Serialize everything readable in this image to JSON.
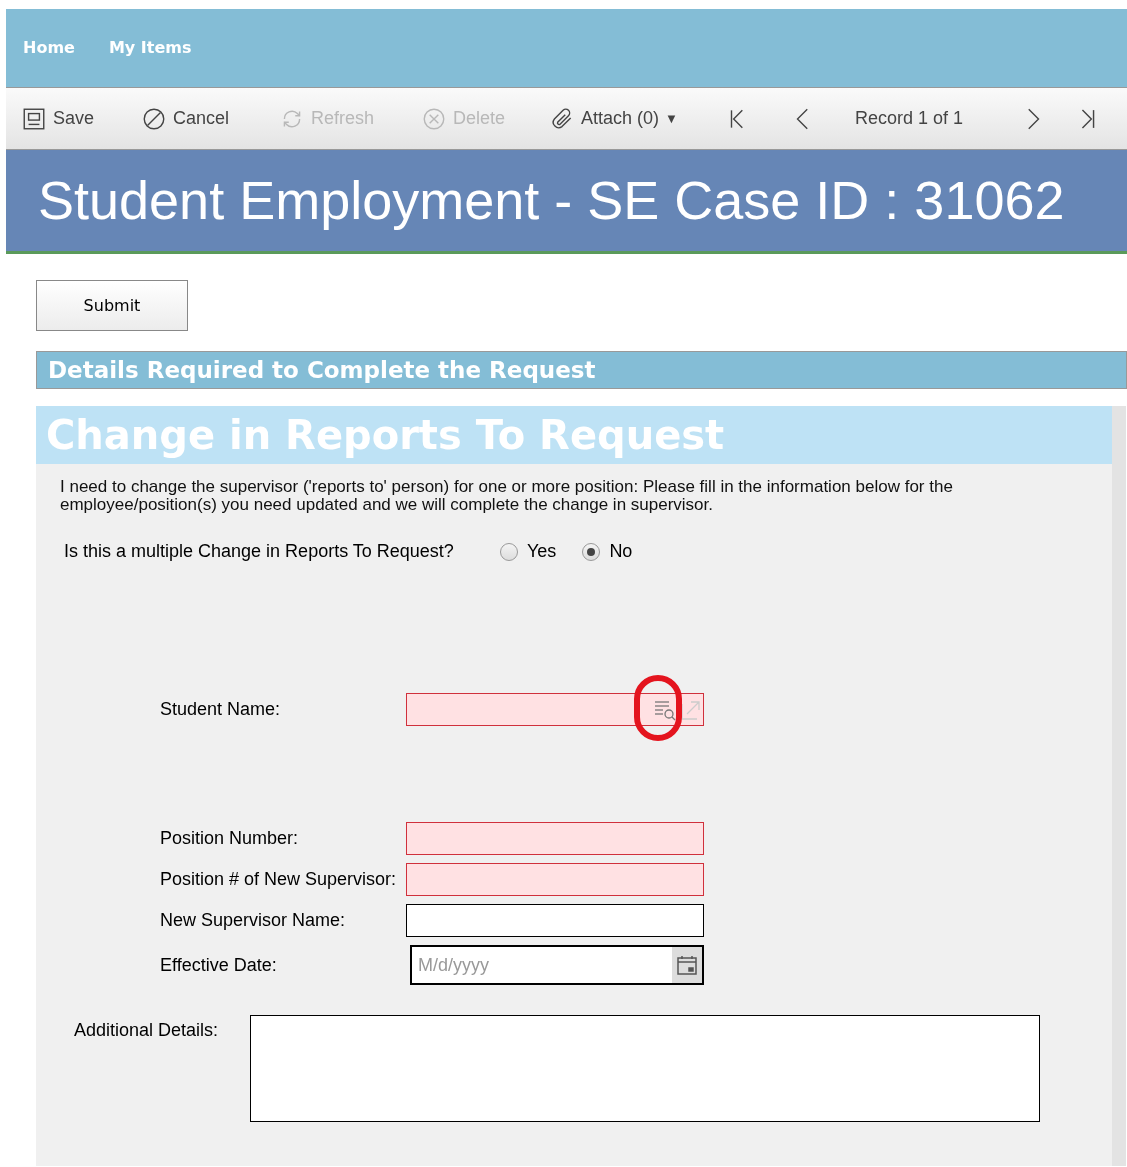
{
  "nav": {
    "items": [
      "Home",
      "My Items"
    ]
  },
  "toolbar": [
    {
      "kind": "save",
      "label": "Save",
      "disabled": false
    },
    {
      "kind": "cancel",
      "label": "Cancel",
      "disabled": false
    },
    {
      "kind": "refresh",
      "label": "Refresh",
      "disabled": true
    },
    {
      "kind": "delete",
      "label": "Delete",
      "disabled": true
    },
    {
      "kind": "attach",
      "label": "Attach (0)",
      "caret": "▼",
      "disabled": false
    },
    {
      "kind": "first",
      "disabled": false
    },
    {
      "kind": "prev",
      "disabled": false
    },
    {
      "kind": "record",
      "label": "Record 1 of 1",
      "disabled": false
    },
    {
      "kind": "next",
      "disabled": false
    },
    {
      "kind": "last",
      "disabled": false
    }
  ],
  "title": "Student Employment - SE Case ID : 31062",
  "submit": "Submit",
  "section_header": "Details Required to Complete the Request",
  "form": {
    "title": "Change in Reports To Request",
    "intro": "I need to change the supervisor ('reports to' person) for one or more position: Please fill in the information below for the employee/position(s) you need updated and we will complete the change in supervisor.",
    "question": "Is this a multiple Change in Reports To Request?",
    "options": [
      {
        "label": "Yes",
        "selected": false
      },
      {
        "label": "No",
        "selected": true
      }
    ],
    "fields": [
      {
        "label": "Student Name:",
        "kind": "lookup",
        "required": true,
        "highlighted": true
      },
      {
        "label": "Position Number:",
        "kind": "text",
        "required": true
      },
      {
        "label": "Position # of New Supervisor:",
        "kind": "text",
        "required": true
      },
      {
        "label": "New Supervisor Name:",
        "kind": "text",
        "required": false
      },
      {
        "label": "Effective Date:",
        "kind": "date",
        "required": false,
        "placeholder": "M/d/yyyy"
      }
    ],
    "details_label": "Additional Details:"
  }
}
